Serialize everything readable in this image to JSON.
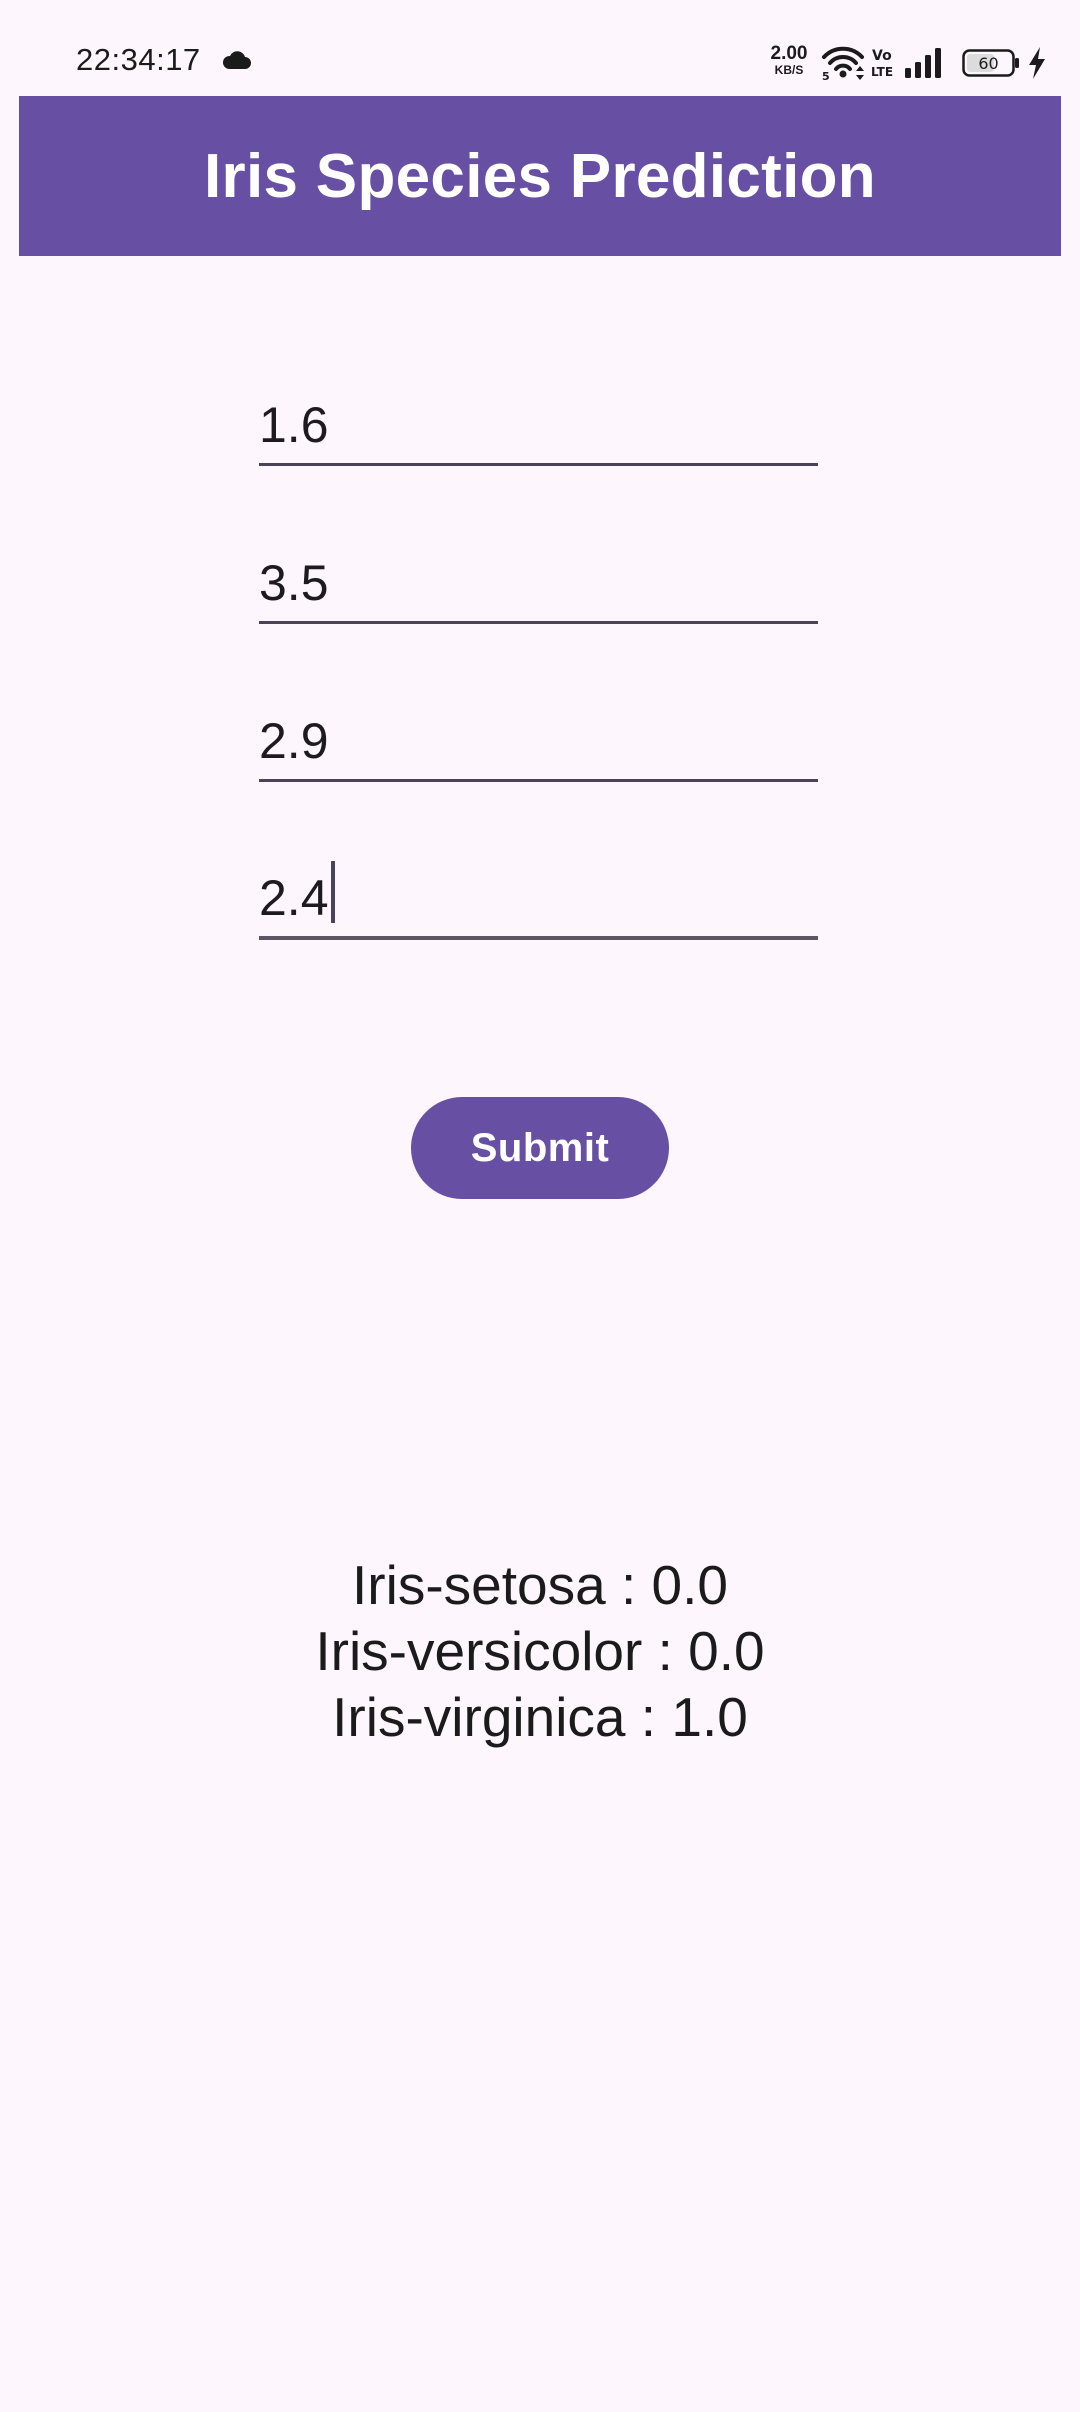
{
  "status_bar": {
    "time": "22:34:17",
    "net_speed_value": "2.00",
    "net_speed_unit": "KB/S",
    "wifi_label": "5",
    "volte_label_top": "Vo",
    "volte_label_bottom": "LTE",
    "battery_level": "60",
    "icons": [
      "cloud-icon",
      "wifi-icon",
      "volte-icon",
      "signal-icon",
      "battery-icon",
      "charging-bolt-icon"
    ]
  },
  "app_bar": {
    "title": "Iris Species Prediction"
  },
  "form": {
    "fields": [
      {
        "value": "1.6"
      },
      {
        "value": "3.5"
      },
      {
        "value": "2.9"
      },
      {
        "value": "2.4"
      }
    ],
    "submit_label": "Submit"
  },
  "results": {
    "lines": [
      "Iris-setosa : 0.0",
      "Iris-versicolor : 0.0",
      "Iris-virginica : 1.0"
    ]
  },
  "colors": {
    "primary": "#6750a4",
    "background": "#fdf6fd",
    "on_primary": "#ffffff",
    "text": "#1d1b20"
  }
}
